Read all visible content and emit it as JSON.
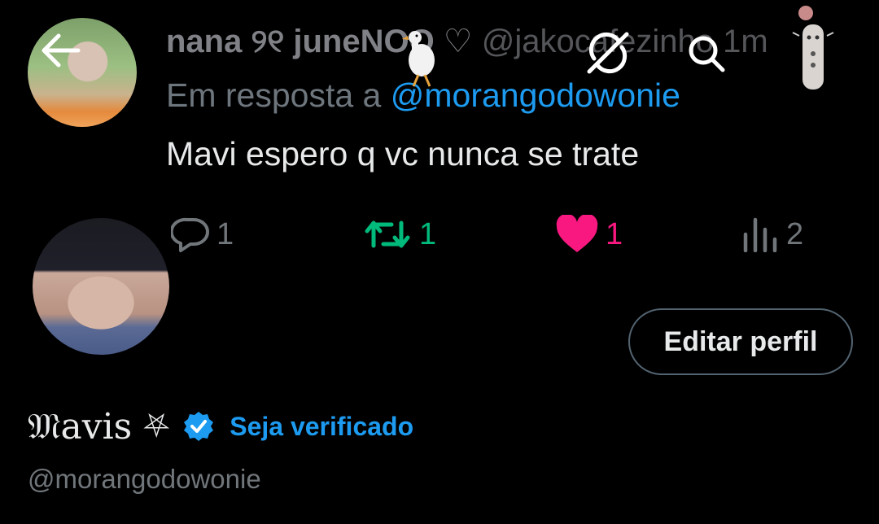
{
  "tweet": {
    "author_name": "nana ୨୧ juneNOO ♡",
    "author_handle": "@jakocafezinho",
    "time": "1m",
    "reply_prefix": "Em resposta a",
    "reply_to": "@morangodowonie",
    "text": "Mavi espero q vc nunca se trate",
    "stats": {
      "replies": "1",
      "retweets": "1",
      "likes": "1",
      "views": "2"
    }
  },
  "profile": {
    "display_name": "𝔐avis",
    "name_symbol": "⛧",
    "verify_label": "Seja verificado",
    "handle": "@morangodowonie",
    "edit_label": "Editar perfil"
  },
  "icons": {
    "back": "arrow-left-icon",
    "sync": "sync-icon",
    "search": "search-icon",
    "reply": "reply-icon",
    "retweet": "retweet-icon",
    "like": "heart-icon",
    "views": "views-icon",
    "verified": "verified-badge-icon"
  },
  "colors": {
    "accent": "#1d9bf0",
    "retweet": "#00ba7c",
    "like": "#f91880",
    "muted": "#71767b",
    "background": "#000000"
  }
}
